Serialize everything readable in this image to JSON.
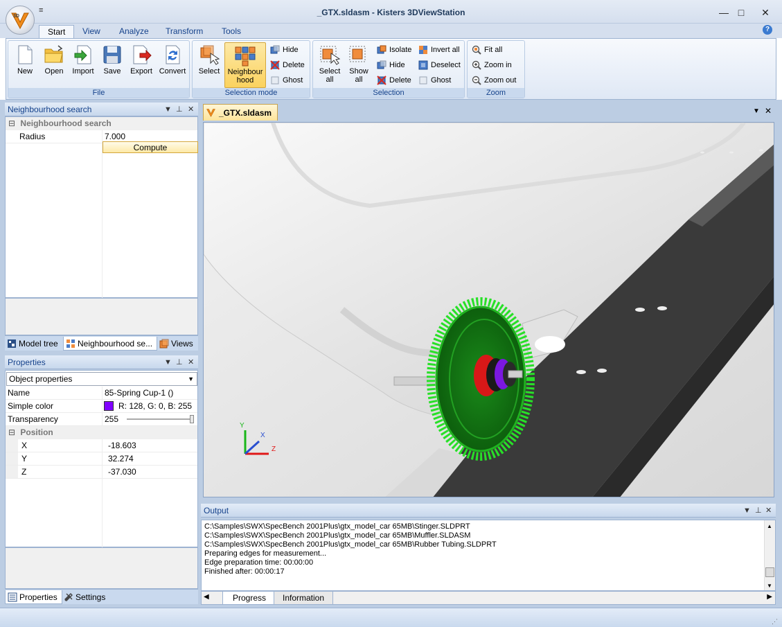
{
  "window": {
    "title": "_GTX.sldasm - Kisters 3DViewStation",
    "qat_label": "≡",
    "minimize": "—",
    "maximize": "□",
    "close": "✕"
  },
  "ribbon": {
    "tabs": [
      "Start",
      "View",
      "Analyze",
      "Transform",
      "Tools"
    ],
    "active_tab": "Start",
    "help": "?",
    "groups": {
      "file": {
        "label": "File",
        "buttons": [
          "New",
          "Open",
          "Import",
          "Save",
          "Export",
          "Convert"
        ]
      },
      "selection_mode": {
        "label": "Selection mode",
        "select": "Select",
        "neighbourhood_line1": "Neighbour",
        "neighbourhood_line2": "hood",
        "hide": "Hide",
        "delete": "Delete",
        "ghost": "Ghost"
      },
      "selection": {
        "label": "Selection",
        "select_all_line1": "Select",
        "select_all_line2": "all",
        "show_all_line1": "Show",
        "show_all_line2": "all",
        "isolate": "Isolate",
        "hide": "Hide",
        "delete": "Delete",
        "invert_all": "Invert all",
        "deselect": "Deselect",
        "ghost": "Ghost"
      },
      "zoom": {
        "label": "Zoom",
        "fit_all": "Fit all",
        "zoom_in": "Zoom in",
        "zoom_out": "Zoom out"
      }
    }
  },
  "neighbourhood_panel": {
    "title": "Neighbourhood search",
    "category": "Neighbourhood search",
    "radius_label": "Radius",
    "radius_value": "7.000",
    "compute_label": "Compute",
    "tabs": [
      "Model tree",
      "Neighbourhood se...",
      "Views"
    ]
  },
  "properties_panel": {
    "title": "Properties",
    "dropdown_value": "Object properties",
    "rows": {
      "name_label": "Name",
      "name_value": "85-Spring Cup-1 ()",
      "color_label": "Simple color",
      "color_value": "R: 128, G: 0, B: 255",
      "color_swatch": "#8000ff",
      "transparency_label": "Transparency",
      "transparency_value": "255",
      "position_label": "Position",
      "x_label": "X",
      "x_value": "-18.603",
      "y_label": "Y",
      "y_value": "32.274",
      "z_label": "Z",
      "z_value": "-37.030"
    },
    "tabs": [
      "Properties",
      "Settings"
    ]
  },
  "document": {
    "tab_label": "_GTX.sldasm",
    "axes": {
      "x": "X",
      "y": "Y",
      "z": "Z"
    },
    "colors": {
      "gear": "#22cc22",
      "spring_cup": "#8000ff",
      "bushing": "#e01818",
      "chassis": "#3a3a3a"
    }
  },
  "output": {
    "title": "Output",
    "lines": [
      "C:\\Samples\\SWX\\SpecBench 2001Plus\\gtx_model_car 65MB\\Stinger.SLDPRT",
      "C:\\Samples\\SWX\\SpecBench 2001Plus\\gtx_model_car 65MB\\Muffler.SLDASM",
      "C:\\Samples\\SWX\\SpecBench 2001Plus\\gtx_model_car 65MB\\Rubber Tubing.SLDPRT",
      "Preparing edges for measurement...",
      "Edge preparation time: 00:00:00",
      "Finished after: 00:00:17"
    ],
    "tabs": [
      "Progress",
      "Information"
    ]
  }
}
